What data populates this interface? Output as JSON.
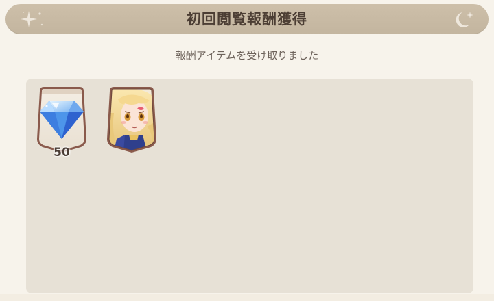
{
  "header": {
    "title": "初回閲覧報酬獲得",
    "left_icon": "sparkle-star-icon",
    "right_icon": "crescent-moon-star-icon"
  },
  "subtitle": "報酬アイテムを受け取りました",
  "items": [
    {
      "name": "gem",
      "icon": "blue-diamond-icon",
      "count": "50"
    },
    {
      "name": "character",
      "icon": "character-portrait-icon",
      "count": ""
    }
  ],
  "colors": {
    "header_bg": "#c8baa4",
    "panel_bg": "#e7e1d6",
    "frame_border": "#8a5a4c",
    "text_dark": "#4c3e34"
  }
}
